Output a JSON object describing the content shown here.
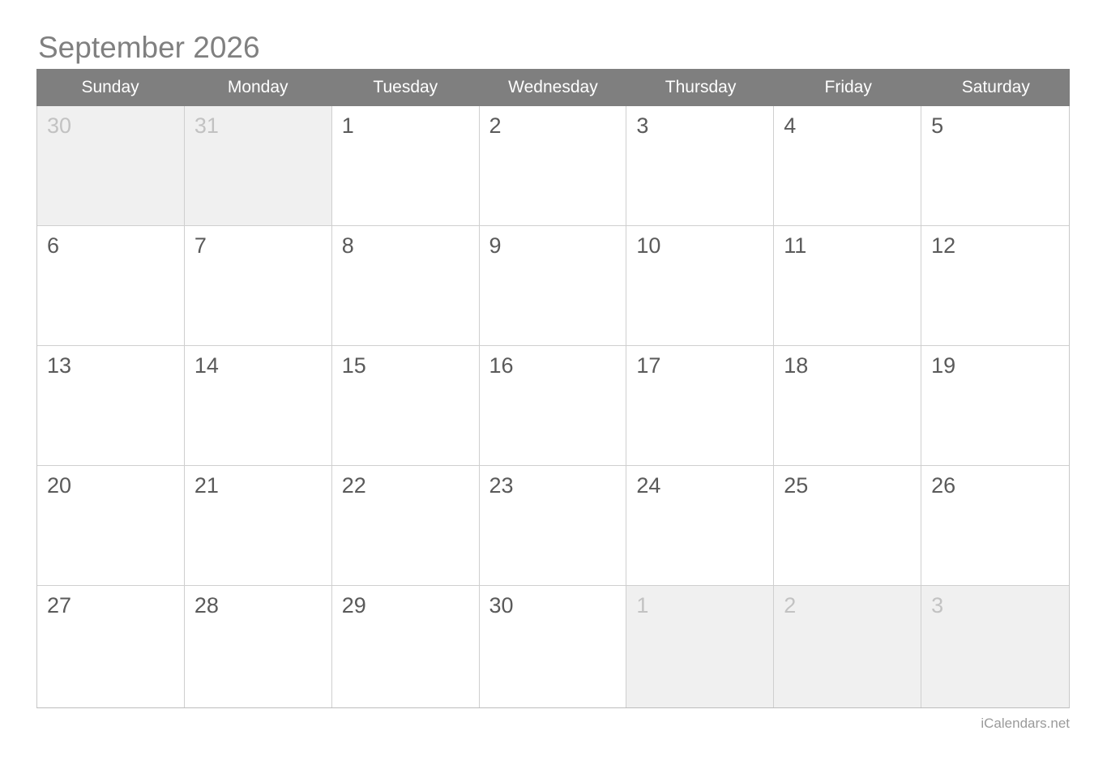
{
  "page": {
    "title": "September 2026",
    "credit": "iCalendars.net",
    "background_color": "#ffffff"
  },
  "colors": {
    "header_bar": "#7f7f7f",
    "header_text": "#ffffff",
    "title_text": "#808080",
    "day_number": "#5a5a5a",
    "day_number_muted": "#c2c2c2",
    "cell_muted_bg": "#f0f0f0",
    "cell_bg": "#ffffff",
    "grid_border": "#cfcfcf",
    "credit_text": "#9a9a9a"
  },
  "calendar": {
    "month": "September",
    "year": "2026",
    "weekday_headers": [
      "Sunday",
      "Monday",
      "Tuesday",
      "Wednesday",
      "Thursday",
      "Friday",
      "Saturday"
    ],
    "weeks": [
      {
        "days": [
          {
            "label": "30",
            "in_month": false
          },
          {
            "label": "31",
            "in_month": false
          },
          {
            "label": "1",
            "in_month": true
          },
          {
            "label": "2",
            "in_month": true
          },
          {
            "label": "3",
            "in_month": true
          },
          {
            "label": "4",
            "in_month": true
          },
          {
            "label": "5",
            "in_month": true
          }
        ]
      },
      {
        "days": [
          {
            "label": "6",
            "in_month": true
          },
          {
            "label": "7",
            "in_month": true
          },
          {
            "label": "8",
            "in_month": true
          },
          {
            "label": "9",
            "in_month": true
          },
          {
            "label": "10",
            "in_month": true
          },
          {
            "label": "11",
            "in_month": true
          },
          {
            "label": "12",
            "in_month": true
          }
        ]
      },
      {
        "days": [
          {
            "label": "13",
            "in_month": true
          },
          {
            "label": "14",
            "in_month": true
          },
          {
            "label": "15",
            "in_month": true
          },
          {
            "label": "16",
            "in_month": true
          },
          {
            "label": "17",
            "in_month": true
          },
          {
            "label": "18",
            "in_month": true
          },
          {
            "label": "19",
            "in_month": true
          }
        ]
      },
      {
        "days": [
          {
            "label": "20",
            "in_month": true
          },
          {
            "label": "21",
            "in_month": true
          },
          {
            "label": "22",
            "in_month": true
          },
          {
            "label": "23",
            "in_month": true
          },
          {
            "label": "24",
            "in_month": true
          },
          {
            "label": "25",
            "in_month": true
          },
          {
            "label": "26",
            "in_month": true
          }
        ]
      },
      {
        "days": [
          {
            "label": "27",
            "in_month": true
          },
          {
            "label": "28",
            "in_month": true
          },
          {
            "label": "29",
            "in_month": true
          },
          {
            "label": "30",
            "in_month": true
          },
          {
            "label": "1",
            "in_month": false
          },
          {
            "label": "2",
            "in_month": false
          },
          {
            "label": "3",
            "in_month": false
          }
        ]
      }
    ]
  }
}
